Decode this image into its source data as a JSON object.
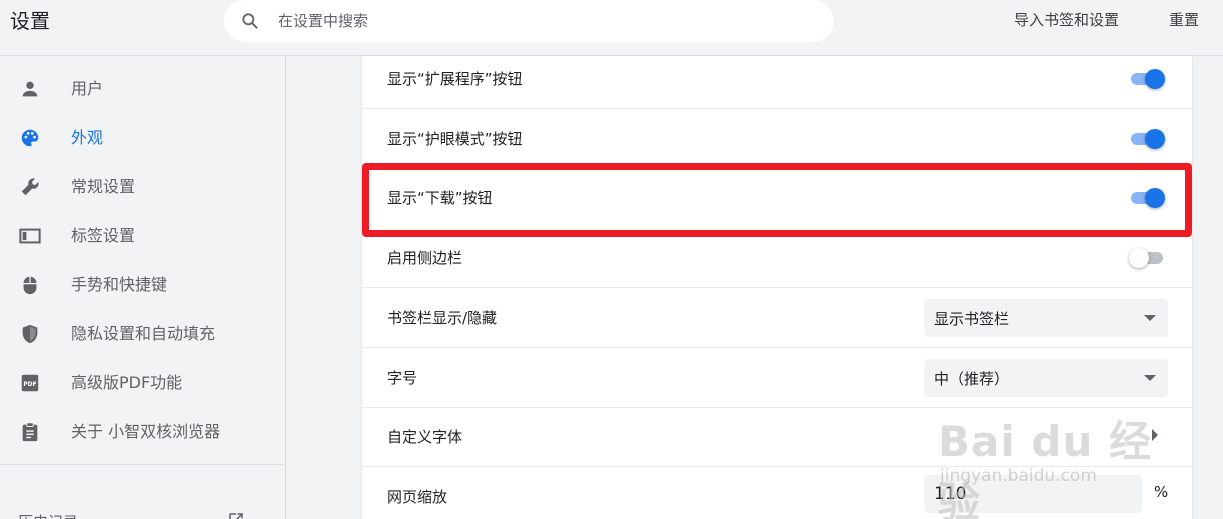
{
  "header": {
    "title": "设置",
    "search_placeholder": "在设置中搜索",
    "import_label": "导入书签和设置",
    "reset_label": "重置"
  },
  "sidebar": {
    "items": [
      {
        "label": "用户",
        "icon": "person-icon",
        "active": false
      },
      {
        "label": "外观",
        "icon": "palette-icon",
        "active": true
      },
      {
        "label": "常规设置",
        "icon": "wrench-icon",
        "active": false
      },
      {
        "label": "标签设置",
        "icon": "tab-icon",
        "active": false
      },
      {
        "label": "手势和快捷键",
        "icon": "mouse-icon",
        "active": false
      },
      {
        "label": "隐私设置和自动填充",
        "icon": "shield-icon",
        "active": false
      },
      {
        "label": "高级版PDF功能",
        "icon": "pdf-icon",
        "active": false
      },
      {
        "label": "关于 小智双核浏览器",
        "icon": "clipboard-icon",
        "active": false
      }
    ],
    "history_label": "历史记录"
  },
  "settings": {
    "rows": [
      {
        "label": "显示“扩展程序”按钮",
        "type": "toggle",
        "on": true
      },
      {
        "label": "显示“护眼模式”按钮",
        "type": "toggle",
        "on": true
      },
      {
        "label": "显示“下载”按钮",
        "type": "toggle",
        "on": true,
        "highlighted": true
      },
      {
        "label": "启用侧边栏",
        "type": "toggle",
        "on": false
      },
      {
        "label": "书签栏显示/隐藏",
        "type": "select",
        "value": "显示书签栏"
      },
      {
        "label": "字号",
        "type": "select",
        "value": "中（推荐）"
      },
      {
        "label": "自定义字体",
        "type": "link"
      },
      {
        "label": "网页缩放",
        "type": "number",
        "value": "110",
        "unit": "%"
      }
    ]
  },
  "watermark": {
    "logo": "Bai du 经验",
    "sub": "jingyan.baidu.com"
  },
  "colors": {
    "accent": "#1a73e8",
    "highlight": "#ec1c24"
  }
}
